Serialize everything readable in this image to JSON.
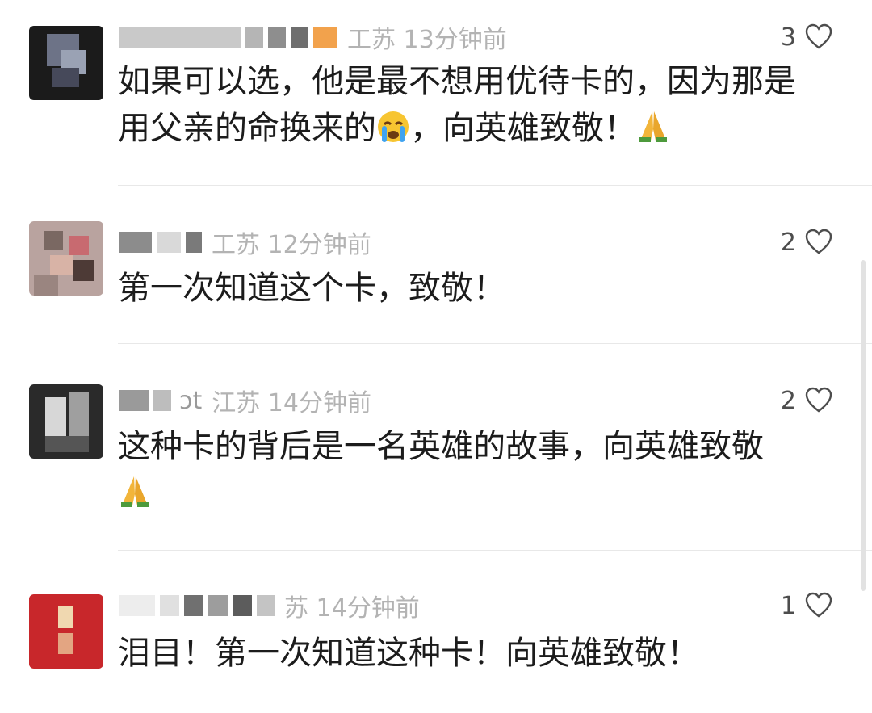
{
  "comments": [
    {
      "location_time": "工苏 13分钟前",
      "text": "如果可以选，他是最不想用优待卡的，因为那是用父亲的命换来的😭，向英雄致敬！🙏",
      "text_part1": "如果可以选，他是最不想用优待卡的，因为那是用父亲的命换来的",
      "text_part2": "，向英雄致敬！",
      "likes": "3"
    },
    {
      "location_time": "工苏 12分钟前",
      "text": "第一次知道这个卡，致敬！",
      "likes": "2"
    },
    {
      "location_time": "江苏 14分钟前",
      "name_suffix": "ɔt",
      "text": "这种卡的背后是一名英雄的故事，向英雄致敬🙏",
      "text_part1": "这种卡的背后是一名英雄的故事，向英雄致敬",
      "likes": "2"
    },
    {
      "location_time": "苏 14分钟前",
      "text": "泪目！第一次知道这种卡！向英雄致敬！",
      "likes": "1"
    }
  ],
  "icons": {
    "like": "heart-outline-icon",
    "crying": "crying-face-emoji",
    "praying": "folded-hands-emoji"
  },
  "colors": {
    "text": "#1c1c1c",
    "meta": "#b3b3b3",
    "like_count": "#4d4d4d",
    "divider": "#e8e8e8"
  }
}
